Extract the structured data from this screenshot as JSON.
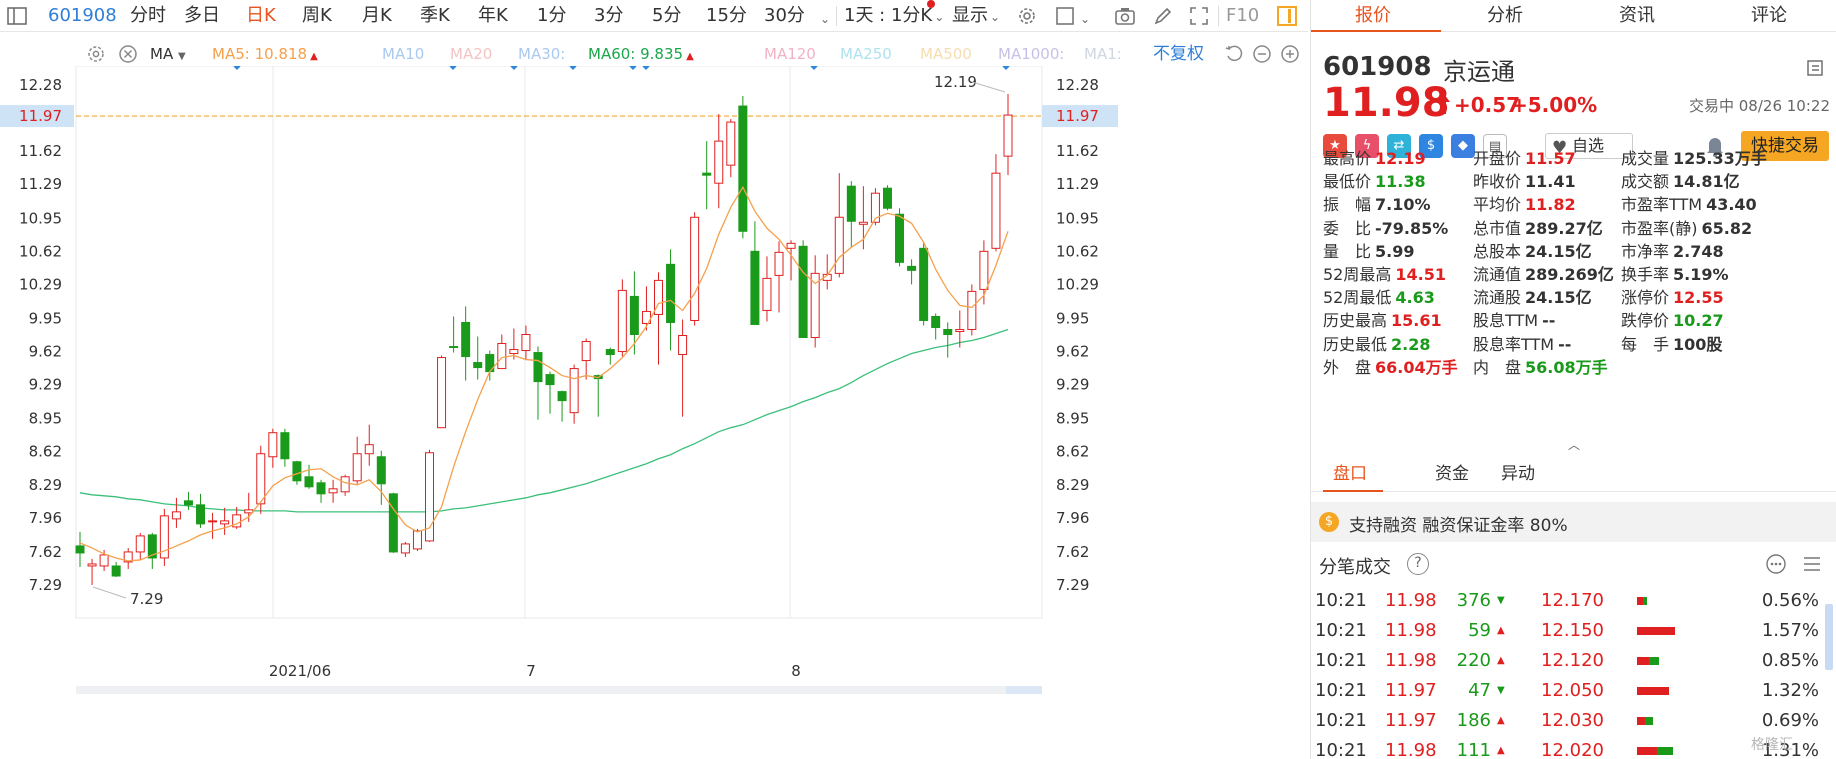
{
  "toolbar": {
    "code": "601908",
    "periods": [
      "分时",
      "多日",
      "日K",
      "周K",
      "月K",
      "季K",
      "年K",
      "1分",
      "3分",
      "5分",
      "15分",
      "30分"
    ],
    "active_period": "日K",
    "one_day": "1天 : 1分K",
    "display": "显示",
    "f10": "F10"
  },
  "ma_legend": {
    "label": "MA",
    "ma5": "MA5: 10.818",
    "ma10": "MA10",
    "ma20": "MA20",
    "ma30": "MA30:",
    "ma60": "MA60: 9.835",
    "ma120": "MA120",
    "ma250": "MA250",
    "ma500": "MA500",
    "ma1000": "MA1000:",
    "ma1": "MA1:",
    "adjust": "不复权"
  },
  "colors": {
    "up": "#e02020",
    "down": "#1a9a1a",
    "ma5": "#f5a04b",
    "ma60": "#3cbf7a",
    "accent": "#e8541e",
    "blue": "#2f7fd8"
  },
  "chart_data": {
    "type": "candlestick",
    "ylim": [
      7.05,
      12.51
    ],
    "y_ticks": [
      "12.28",
      "11.97",
      "11.62",
      "11.29",
      "10.95",
      "10.62",
      "10.29",
      "9.95",
      "9.62",
      "9.29",
      "8.95",
      "8.62",
      "8.29",
      "7.96",
      "7.62",
      "7.29"
    ],
    "x_labels": [
      "2021/06",
      "7",
      "8"
    ],
    "current_price_label": "11.97",
    "high_annotation": "12.19",
    "low_annotation": "7.29",
    "candles": [
      {
        "o": 7.68,
        "c": 7.61,
        "h": 7.82,
        "l": 7.47
      },
      {
        "o": 7.48,
        "c": 7.5,
        "h": 7.55,
        "l": 7.29
      },
      {
        "o": 7.48,
        "c": 7.59,
        "h": 7.64,
        "l": 7.43
      },
      {
        "o": 7.48,
        "c": 7.38,
        "h": 7.52,
        "l": 7.37
      },
      {
        "o": 7.52,
        "c": 7.62,
        "h": 7.66,
        "l": 7.45
      },
      {
        "o": 7.62,
        "c": 7.78,
        "h": 7.81,
        "l": 7.54
      },
      {
        "o": 7.79,
        "c": 7.56,
        "h": 7.81,
        "l": 7.45
      },
      {
        "o": 7.56,
        "c": 7.98,
        "h": 8.05,
        "l": 7.48
      },
      {
        "o": 7.95,
        "c": 8.02,
        "h": 8.16,
        "l": 7.86
      },
      {
        "o": 8.13,
        "c": 8.09,
        "h": 8.22,
        "l": 8.04
      },
      {
        "o": 8.09,
        "c": 7.9,
        "h": 8.2,
        "l": 7.86
      },
      {
        "o": 7.93,
        "c": 7.93,
        "h": 8.01,
        "l": 7.75
      },
      {
        "o": 7.9,
        "c": 7.93,
        "h": 8.06,
        "l": 7.79
      },
      {
        "o": 7.87,
        "c": 7.99,
        "h": 8.07,
        "l": 7.85
      },
      {
        "o": 8.01,
        "c": 8.04,
        "h": 8.21,
        "l": 7.92
      },
      {
        "o": 8.1,
        "c": 8.6,
        "h": 8.68,
        "l": 8.0
      },
      {
        "o": 8.57,
        "c": 8.81,
        "h": 8.85,
        "l": 8.46
      },
      {
        "o": 8.81,
        "c": 8.55,
        "h": 8.85,
        "l": 8.47
      },
      {
        "o": 8.52,
        "c": 8.33,
        "h": 8.53,
        "l": 8.29
      },
      {
        "o": 8.37,
        "c": 8.27,
        "h": 8.49,
        "l": 8.25
      },
      {
        "o": 8.31,
        "c": 8.2,
        "h": 8.34,
        "l": 8.11
      },
      {
        "o": 8.21,
        "c": 8.25,
        "h": 8.34,
        "l": 8.11
      },
      {
        "o": 8.22,
        "c": 8.37,
        "h": 8.39,
        "l": 8.18
      },
      {
        "o": 8.33,
        "c": 8.6,
        "h": 8.77,
        "l": 8.3
      },
      {
        "o": 8.6,
        "c": 8.69,
        "h": 8.89,
        "l": 8.48
      },
      {
        "o": 8.57,
        "c": 8.3,
        "h": 8.63,
        "l": 8.09
      },
      {
        "o": 8.2,
        "c": 7.62,
        "h": 8.21,
        "l": 7.61
      },
      {
        "o": 7.61,
        "c": 7.7,
        "h": 7.72,
        "l": 7.57
      },
      {
        "o": 7.65,
        "c": 7.83,
        "h": 7.85,
        "l": 7.63
      },
      {
        "o": 7.73,
        "c": 8.61,
        "h": 8.64,
        "l": 7.72
      },
      {
        "o": 8.86,
        "c": 9.56,
        "h": 9.58,
        "l": 8.87
      },
      {
        "o": 9.67,
        "c": 9.66,
        "h": 9.97,
        "l": 9.61
      },
      {
        "o": 9.91,
        "c": 9.57,
        "h": 10.07,
        "l": 9.33
      },
      {
        "o": 9.51,
        "c": 9.46,
        "h": 9.77,
        "l": 9.34
      },
      {
        "o": 9.59,
        "c": 9.42,
        "h": 9.63,
        "l": 9.33
      },
      {
        "o": 9.45,
        "c": 9.7,
        "h": 9.79,
        "l": 9.45
      },
      {
        "o": 9.6,
        "c": 9.64,
        "h": 9.85,
        "l": 9.54
      },
      {
        "o": 9.63,
        "c": 9.79,
        "h": 9.88,
        "l": 9.54
      },
      {
        "o": 9.61,
        "c": 9.32,
        "h": 9.67,
        "l": 8.94
      },
      {
        "o": 9.39,
        "c": 9.29,
        "h": 9.42,
        "l": 9.0
      },
      {
        "o": 9.22,
        "c": 9.13,
        "h": 9.23,
        "l": 8.92
      },
      {
        "o": 9.01,
        "c": 9.45,
        "h": 9.49,
        "l": 8.9
      },
      {
        "o": 9.53,
        "c": 9.72,
        "h": 9.75,
        "l": 9.34
      },
      {
        "o": 9.38,
        "c": 9.35,
        "h": 9.39,
        "l": 8.97
      },
      {
        "o": 9.64,
        "c": 9.59,
        "h": 9.66,
        "l": 9.49
      },
      {
        "o": 9.62,
        "c": 10.23,
        "h": 10.34,
        "l": 9.57
      },
      {
        "o": 10.17,
        "c": 9.79,
        "h": 10.42,
        "l": 9.59
      },
      {
        "o": 9.9,
        "c": 10.02,
        "h": 10.27,
        "l": 9.83
      },
      {
        "o": 9.99,
        "c": 10.33,
        "h": 10.41,
        "l": 9.49
      },
      {
        "o": 10.49,
        "c": 9.91,
        "h": 10.64,
        "l": 9.63
      },
      {
        "o": 9.59,
        "c": 9.78,
        "h": 9.94,
        "l": 8.97
      },
      {
        "o": 9.93,
        "c": 10.96,
        "h": 11.01,
        "l": 9.88
      },
      {
        "o": 11.4,
        "c": 11.38,
        "h": 11.72,
        "l": 11.04
      },
      {
        "o": 11.3,
        "c": 11.72,
        "h": 11.99,
        "l": 11.05
      },
      {
        "o": 11.48,
        "c": 11.91,
        "h": 11.94,
        "l": 11.36
      },
      {
        "o": 12.07,
        "c": 10.82,
        "h": 12.17,
        "l": 10.75
      },
      {
        "o": 10.62,
        "c": 9.89,
        "h": 10.92,
        "l": 9.92
      },
      {
        "o": 10.03,
        "c": 10.35,
        "h": 10.57,
        "l": 9.92
      },
      {
        "o": 10.38,
        "c": 10.61,
        "h": 10.72,
        "l": 10.01
      },
      {
        "o": 10.65,
        "c": 10.7,
        "h": 10.73,
        "l": 10.33
      },
      {
        "o": 10.67,
        "c": 9.76,
        "h": 10.73,
        "l": 9.76
      },
      {
        "o": 9.76,
        "c": 10.4,
        "h": 10.58,
        "l": 9.66
      },
      {
        "o": 10.33,
        "c": 10.39,
        "h": 10.59,
        "l": 10.24
      },
      {
        "o": 10.4,
        "c": 10.96,
        "h": 11.4,
        "l": 10.36
      },
      {
        "o": 11.27,
        "c": 10.92,
        "h": 11.32,
        "l": 10.66
      },
      {
        "o": 10.89,
        "c": 10.91,
        "h": 11.27,
        "l": 10.64
      },
      {
        "o": 10.91,
        "c": 11.2,
        "h": 11.25,
        "l": 10.88
      },
      {
        "o": 11.25,
        "c": 11.05,
        "h": 11.28,
        "l": 11.03
      },
      {
        "o": 10.99,
        "c": 10.51,
        "h": 11.05,
        "l": 10.47
      },
      {
        "o": 10.47,
        "c": 10.43,
        "h": 10.54,
        "l": 10.29
      },
      {
        "o": 10.65,
        "c": 9.93,
        "h": 10.71,
        "l": 9.88
      },
      {
        "o": 9.97,
        "c": 9.86,
        "h": 10.0,
        "l": 9.74
      },
      {
        "o": 9.84,
        "c": 9.79,
        "h": 9.91,
        "l": 9.56
      },
      {
        "o": 9.82,
        "c": 9.84,
        "h": 10.03,
        "l": 9.66
      },
      {
        "o": 9.84,
        "c": 10.22,
        "h": 10.29,
        "l": 9.78
      },
      {
        "o": 10.24,
        "c": 10.62,
        "h": 10.73,
        "l": 10.09
      },
      {
        "o": 10.65,
        "c": 11.4,
        "h": 11.59,
        "l": 10.62
      },
      {
        "o": 11.57,
        "c": 11.98,
        "h": 12.19,
        "l": 11.38
      }
    ],
    "ma5": [
      7.71,
      7.66,
      7.6,
      7.56,
      7.53,
      7.54,
      7.59,
      7.63,
      7.68,
      7.73,
      7.79,
      7.83,
      7.86,
      7.9,
      7.97,
      8.12,
      8.28,
      8.36,
      8.4,
      8.44,
      8.45,
      8.37,
      8.31,
      8.29,
      8.34,
      8.22,
      8.05,
      7.89,
      7.82,
      7.86,
      8.07,
      8.47,
      8.82,
      9.14,
      9.42,
      9.56,
      9.58,
      9.54,
      9.53,
      9.46,
      9.38,
      9.35,
      9.38,
      9.36,
      9.45,
      9.56,
      9.7,
      9.87,
      10.1,
      10.13,
      10.03,
      10.2,
      10.45,
      10.79,
      11.06,
      11.26,
      11.02,
      10.85,
      10.74,
      10.58,
      10.41,
      10.3,
      10.38,
      10.56,
      10.66,
      10.74,
      10.95,
      11.0,
      10.97,
      10.9,
      10.71,
      10.44,
      10.23,
      10.08,
      10.06,
      10.18,
      10.48,
      10.82
    ],
    "ma60": [
      8.21,
      8.19,
      8.18,
      8.17,
      8.15,
      8.14,
      8.12,
      8.1,
      8.09,
      8.08,
      8.06,
      8.05,
      8.04,
      8.04,
      8.03,
      8.03,
      8.03,
      8.03,
      8.02,
      8.02,
      8.02,
      8.02,
      8.02,
      8.02,
      8.02,
      8.02,
      8.02,
      8.02,
      8.02,
      8.02,
      8.03,
      8.05,
      8.06,
      8.08,
      8.1,
      8.12,
      8.14,
      8.16,
      8.19,
      8.21,
      8.24,
      8.27,
      8.3,
      8.34,
      8.38,
      8.42,
      8.46,
      8.5,
      8.55,
      8.59,
      8.65,
      8.7,
      8.76,
      8.82,
      8.86,
      8.89,
      8.94,
      8.99,
      9.03,
      9.07,
      9.12,
      9.16,
      9.21,
      9.25,
      9.31,
      9.38,
      9.44,
      9.5,
      9.55,
      9.6,
      9.63,
      9.66,
      9.68,
      9.71,
      9.73,
      9.76,
      9.8,
      9.84
    ]
  },
  "panel": {
    "tabs": [
      "报价",
      "分析",
      "资讯",
      "评论"
    ],
    "code": "601908",
    "name": "京运通",
    "price": "11.98",
    "change": "+0.57",
    "change_pct": "+5.00%",
    "status": "交易中 08/26 10:22",
    "fav": "自选",
    "quick_trade": "快捷交易",
    "quotes": [
      [
        {
          "l": "最高价",
          "v": "12.19",
          "c": "red"
        },
        {
          "l": "开盘价",
          "v": "11.57",
          "c": "red"
        },
        {
          "l": "成交量",
          "v": "125.33万手",
          "c": "dark"
        }
      ],
      [
        {
          "l": "最低价",
          "v": "11.38",
          "c": "green"
        },
        {
          "l": "昨收价",
          "v": "11.41",
          "c": "dark"
        },
        {
          "l": "成交额",
          "v": "14.81亿",
          "c": "dark"
        }
      ],
      [
        {
          "l": "振　幅",
          "v": "7.10%",
          "c": "dark"
        },
        {
          "l": "平均价",
          "v": "11.82",
          "c": "red"
        },
        {
          "l": "市盈率TTM",
          "v": "43.40",
          "c": "dark"
        }
      ],
      [
        {
          "l": "委　比",
          "v": "-79.85%",
          "c": "dark"
        },
        {
          "l": "总市值",
          "v": "289.27亿",
          "c": "dark"
        },
        {
          "l": "市盈率(静)",
          "v": "65.82",
          "c": "dark"
        }
      ],
      [
        {
          "l": "量　比",
          "v": "5.99",
          "c": "dark"
        },
        {
          "l": "总股本",
          "v": "24.15亿",
          "c": "dark"
        },
        {
          "l": "市净率",
          "v": "2.748",
          "c": "dark"
        }
      ],
      [
        {
          "l": "52周最高",
          "v": "14.51",
          "c": "red"
        },
        {
          "l": "流通值",
          "v": "289.269亿",
          "c": "dark"
        },
        {
          "l": "换手率",
          "v": "5.19%",
          "c": "dark"
        }
      ],
      [
        {
          "l": "52周最低",
          "v": "4.63",
          "c": "green"
        },
        {
          "l": "流通股",
          "v": "24.15亿",
          "c": "dark"
        },
        {
          "l": "涨停价",
          "v": "12.55",
          "c": "red"
        }
      ],
      [
        {
          "l": "历史最高",
          "v": "15.61",
          "c": "red"
        },
        {
          "l": "股息TTM",
          "v": "--",
          "c": "dark"
        },
        {
          "l": "跌停价",
          "v": "10.27",
          "c": "green"
        }
      ],
      [
        {
          "l": "历史最低",
          "v": "2.28",
          "c": "green"
        },
        {
          "l": "股息率TTM",
          "v": "--",
          "c": "dark"
        },
        {
          "l": "每　手",
          "v": "100股",
          "c": "dark"
        }
      ],
      [
        {
          "l": "外　盘",
          "v": "66.04万手",
          "c": "red"
        },
        {
          "l": "内　盘",
          "v": "56.08万手",
          "c": "green"
        }
      ]
    ],
    "sub_tabs": [
      "盘口",
      "资金",
      "异动"
    ],
    "margin_text": "支持融资 融资保证金率 80%",
    "ticks_title": "分笔成交",
    "ticks": [
      {
        "time": "10:21",
        "price": "11.98",
        "vol": "376",
        "dir": "down",
        "bprice": "12.170",
        "pct": "0.56%",
        "bar": [
          0.15,
          0.1
        ]
      },
      {
        "time": "10:21",
        "price": "11.98",
        "vol": "59",
        "dir": "up",
        "bprice": "12.150",
        "pct": "1.57%",
        "bar": [
          0.95,
          0.0
        ]
      },
      {
        "time": "10:21",
        "price": "11.98",
        "vol": "220",
        "dir": "up",
        "bprice": "12.120",
        "pct": "0.85%",
        "bar": [
          0.3,
          0.25
        ]
      },
      {
        "time": "10:21",
        "price": "11.97",
        "vol": "47",
        "dir": "down",
        "bprice": "12.050",
        "pct": "1.32%",
        "bar": [
          0.8,
          0.0
        ]
      },
      {
        "time": "10:21",
        "price": "11.97",
        "vol": "186",
        "dir": "up",
        "bprice": "12.030",
        "pct": "0.69%",
        "bar": [
          0.2,
          0.2
        ]
      },
      {
        "time": "10:21",
        "price": "11.98",
        "vol": "111",
        "dir": "up",
        "bprice": "12.020",
        "pct": "1.31%",
        "bar": [
          0.5,
          0.4
        ]
      }
    ],
    "watermark": "格隆汇"
  }
}
